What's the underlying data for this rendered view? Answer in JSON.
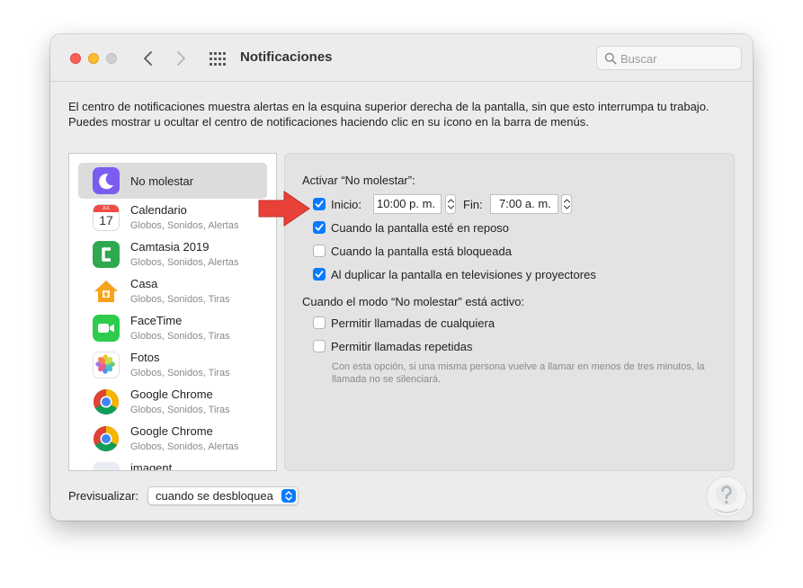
{
  "window": {
    "title": "Notificaciones",
    "search_placeholder": "Buscar"
  },
  "description": "El centro de notificaciones muestra alertas en la esquina superior derecha de la pantalla, sin que esto interrumpa tu trabajo. Puedes mostrar u ocultar el centro de notificaciones haciendo clic en su ícono en la barra de menús.",
  "apps": [
    {
      "name": "No molestar",
      "subtitle": "",
      "icon": "moon-icon",
      "selected": true
    },
    {
      "name": "Calendario",
      "subtitle": "Globos, Sonidos, Alertas",
      "icon": "calendar-icon",
      "cal_month": "JUL",
      "cal_day": "17"
    },
    {
      "name": "Camtasia 2019",
      "subtitle": "Globos, Sonidos, Alertas",
      "icon": "camtasia-icon"
    },
    {
      "name": "Casa",
      "subtitle": "Globos, Sonidos, Tiras",
      "icon": "home-icon"
    },
    {
      "name": "FaceTime",
      "subtitle": "Globos, Sonidos, Tiras",
      "icon": "facetime-icon"
    },
    {
      "name": "Fotos",
      "subtitle": "Globos, Sonidos, Tiras",
      "icon": "photos-icon"
    },
    {
      "name": "Google Chrome",
      "subtitle": "Globos, Sonidos, Tiras",
      "icon": "chrome-icon"
    },
    {
      "name": "Google Chrome",
      "subtitle": "Globos, Sonidos, Alertas",
      "icon": "chrome-icon"
    },
    {
      "name": "imagent",
      "subtitle": "",
      "icon": "imagent-icon"
    }
  ],
  "dnd": {
    "heading": "Activar “No molestar”:",
    "start_label": "Inicio:",
    "start_time": "10:00 p. m.",
    "end_label": "Fin:",
    "end_time": "7:00 a. m.",
    "schedule_checked": true,
    "options": [
      {
        "label": "Cuando la pantalla esté en reposo",
        "checked": true
      },
      {
        "label": "Cuando la pantalla está bloqueada",
        "checked": false
      },
      {
        "label": "Al duplicar la pantalla en televisiones y proyectores",
        "checked": true
      }
    ],
    "active_heading": "Cuando el modo “No molestar” está activo:",
    "active_options": [
      {
        "label": "Permitir llamadas de cualquiera",
        "checked": false
      },
      {
        "label": "Permitir llamadas repetidas",
        "checked": false
      }
    ],
    "note": "Con esta opción, si una misma persona vuelve a llamar en menos de tres minutos, la llamada no se silenciará."
  },
  "preview": {
    "label": "Previsualizar:",
    "value": "cuando se desbloquea"
  },
  "colors": {
    "accent": "#0a7aff",
    "annotation_arrow": "#e8413a"
  }
}
